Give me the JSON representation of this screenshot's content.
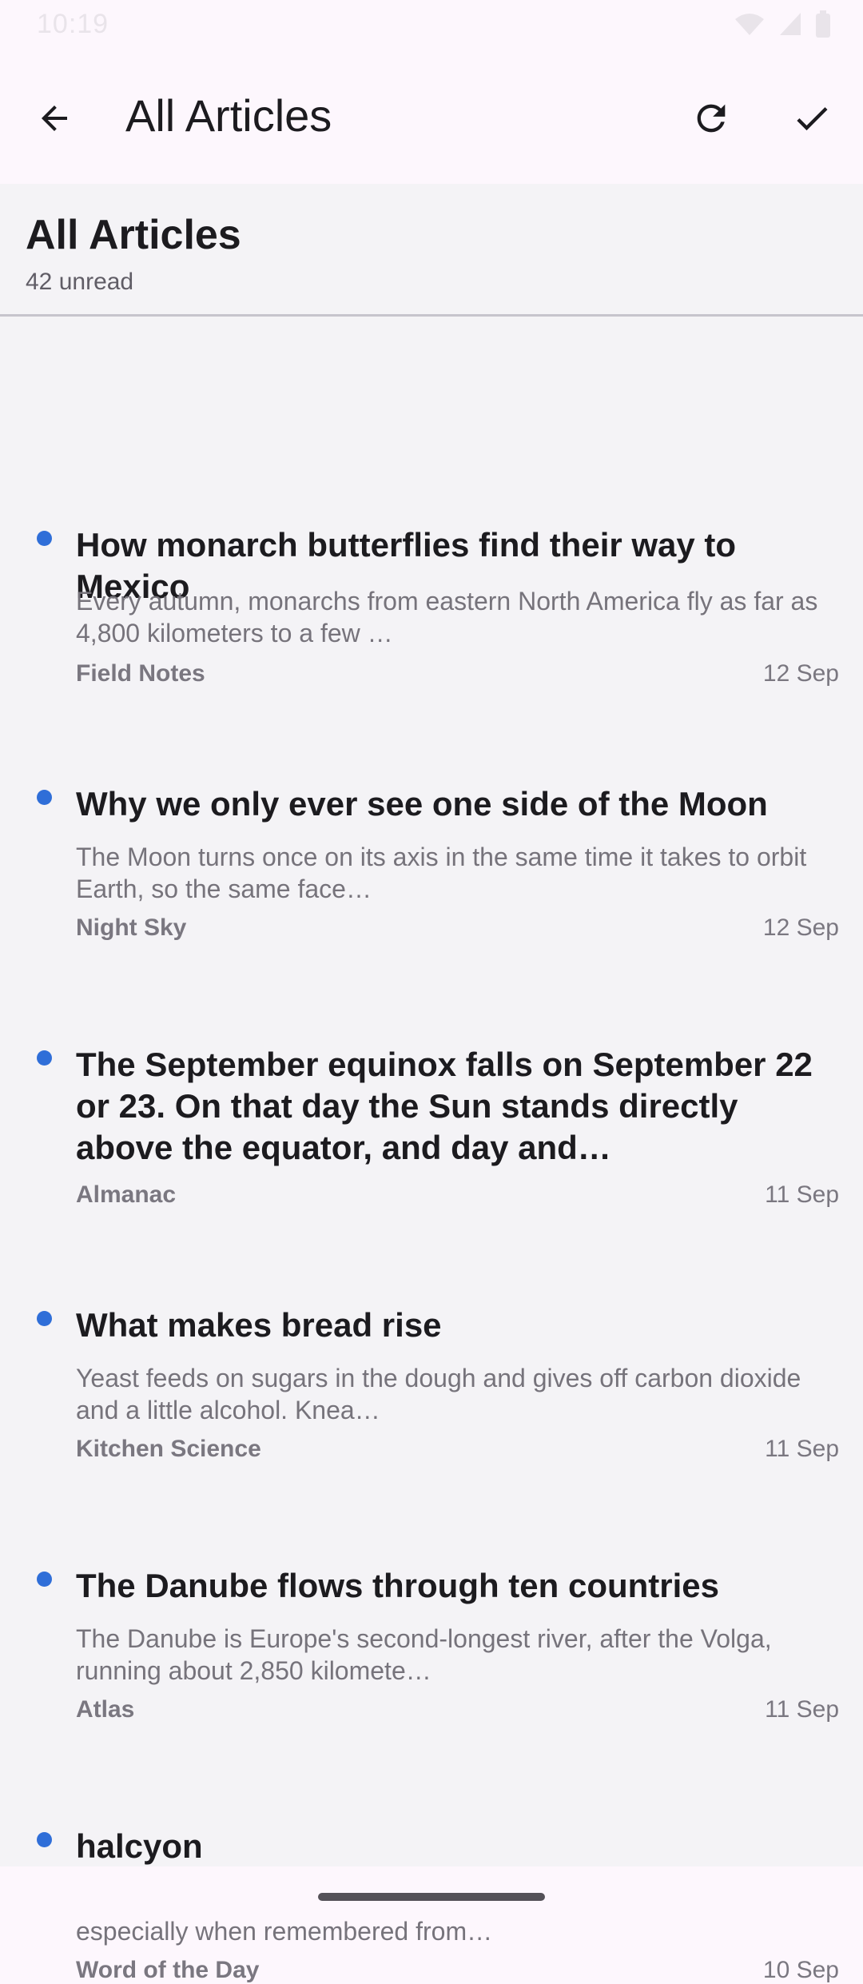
{
  "status_bar": {
    "time": "10:19"
  },
  "app_bar": {
    "title": "All Articles"
  },
  "list_header": {
    "title": "All Articles",
    "unread": "42 unread"
  },
  "articles": [
    {
      "title": "How monarch butterflies find their way to Mexico",
      "snippet": "Every autumn, monarchs from eastern North America fly as far as 4,800 kilometers to a few …",
      "source": "Field Notes",
      "date": "12 Sep",
      "unread": true
    },
    {
      "title": "Why we only ever see one side of the Moon",
      "snippet": "The Moon turns once on its axis in the same time it takes to orbit Earth, so the same face…",
      "source": "Night Sky",
      "date": "12 Sep",
      "unread": true
    },
    {
      "title": "The September equinox falls on September 22 or 23. On that day the Sun stands directly above the equator, and day and…",
      "snippet": "",
      "source": "Almanac",
      "date": "11 Sep",
      "unread": true
    },
    {
      "title": "What makes bread rise",
      "snippet": "Yeast feeds on sugars in the dough and gives off carbon dioxide and a little alcohol. Knea…",
      "source": "Kitchen Science",
      "date": "11 Sep",
      "unread": true
    },
    {
      "title": "The Danube flows through ten countries",
      "snippet": "The Danube is Europe's second-longest river, after the Volga, running about 2,850 kilomete…",
      "source": "Atlas",
      "date": "11 Sep",
      "unread": true
    },
    {
      "title": "halcyon",
      "snippet": "halcyon · adjective Calm and peaceful; happy and carefree, especially when remembered from…",
      "source": "Word of the Day",
      "date": "10 Sep",
      "unread": true
    }
  ],
  "colors": {
    "unread_dot": "#2f6ed8",
    "app_bar_bg": "#fdf7fd",
    "list_bg": "#f4f3f6"
  },
  "icons": {
    "back": "arrow-back-icon",
    "refresh": "refresh-icon",
    "mark_read": "check-icon"
  }
}
